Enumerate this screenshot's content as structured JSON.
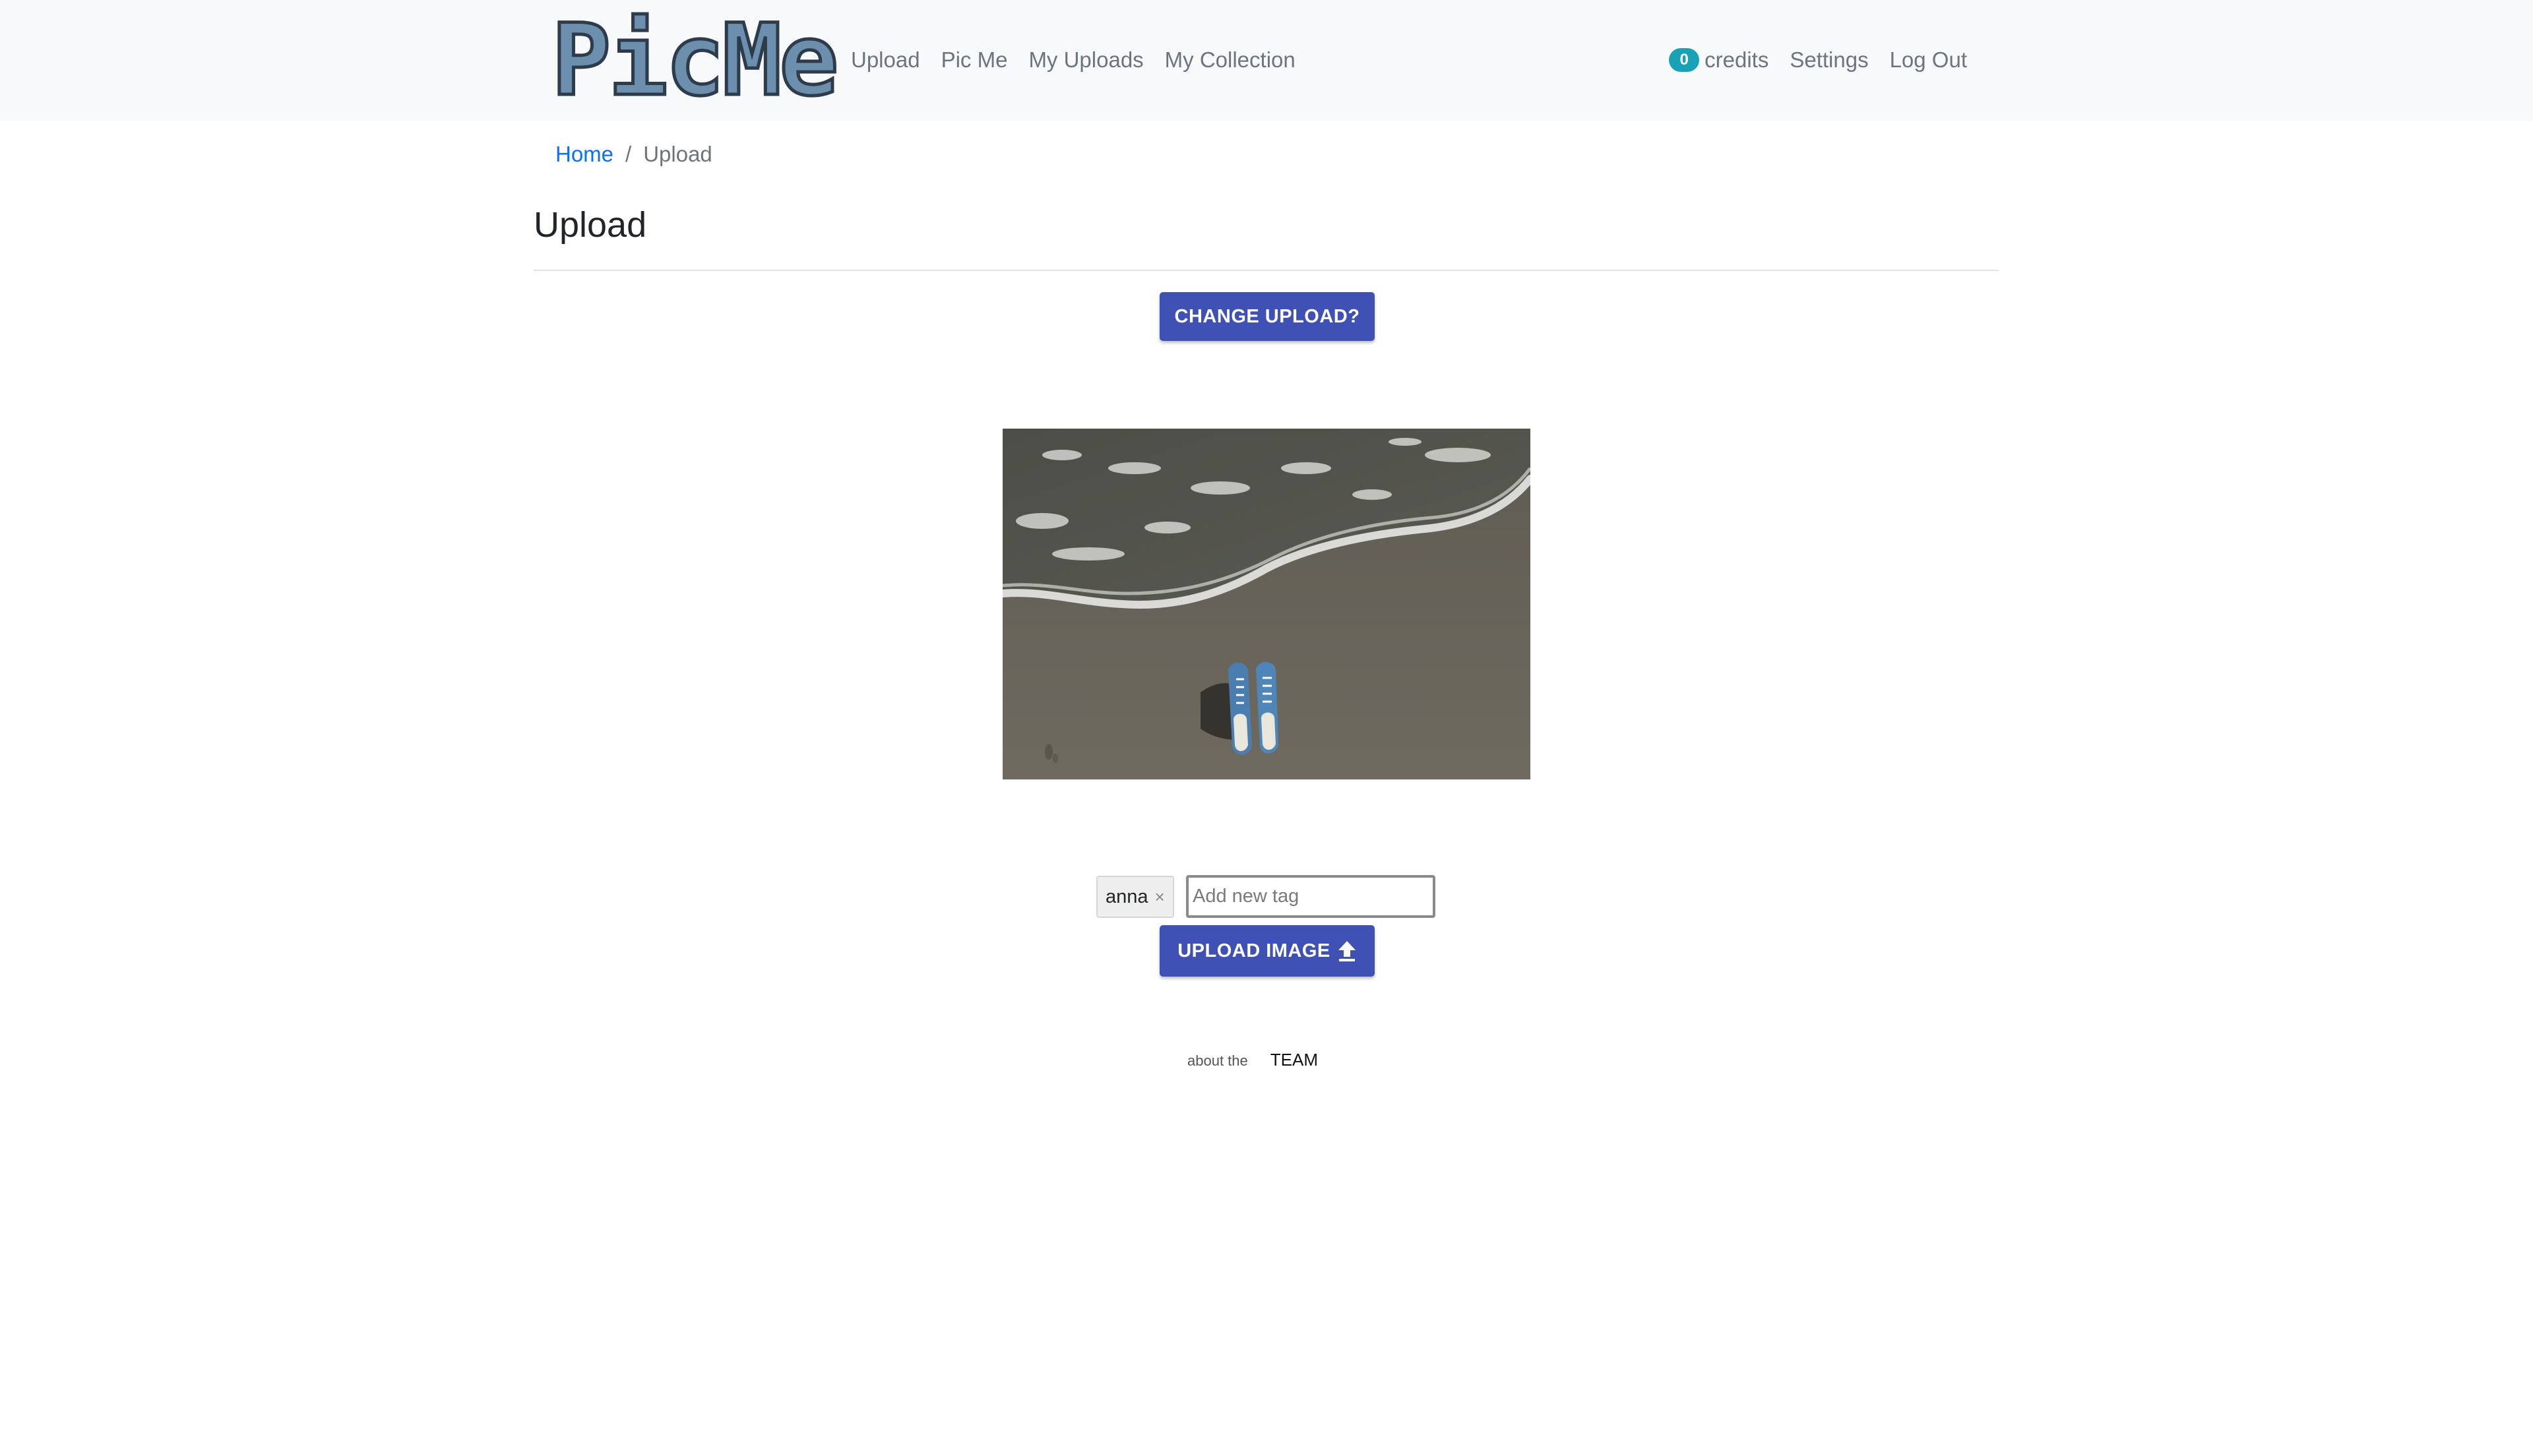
{
  "brand": {
    "logo_text": "PicMe"
  },
  "nav": {
    "left_links": [
      "Upload",
      "Pic Me",
      "My Uploads",
      "My Collection"
    ],
    "credits_count": "0",
    "credits_label": "credits",
    "settings": "Settings",
    "logout": "Log Out"
  },
  "breadcrumb": {
    "home": "Home",
    "separator": "/",
    "current": "Upload"
  },
  "page": {
    "title": "Upload"
  },
  "actions": {
    "change_upload": "CHANGE UPLOAD?",
    "upload_image": "UPLOAD IMAGE"
  },
  "image": {
    "subject": "pair of blue sneakers on wet beach sand beside a wave"
  },
  "tags": {
    "items": [
      {
        "label": "anna",
        "remove": "×"
      }
    ],
    "input_placeholder": "Add new tag"
  },
  "footer": {
    "prefix": "about the",
    "link": "TEAM"
  },
  "colors": {
    "navbar_bg": "#f8f9fa",
    "primary_button": "#3f51b5",
    "badge": "#17a2b8",
    "link": "#0d6efd"
  },
  "icons": {
    "upload_button_icon": "upload-arrow-icon"
  }
}
